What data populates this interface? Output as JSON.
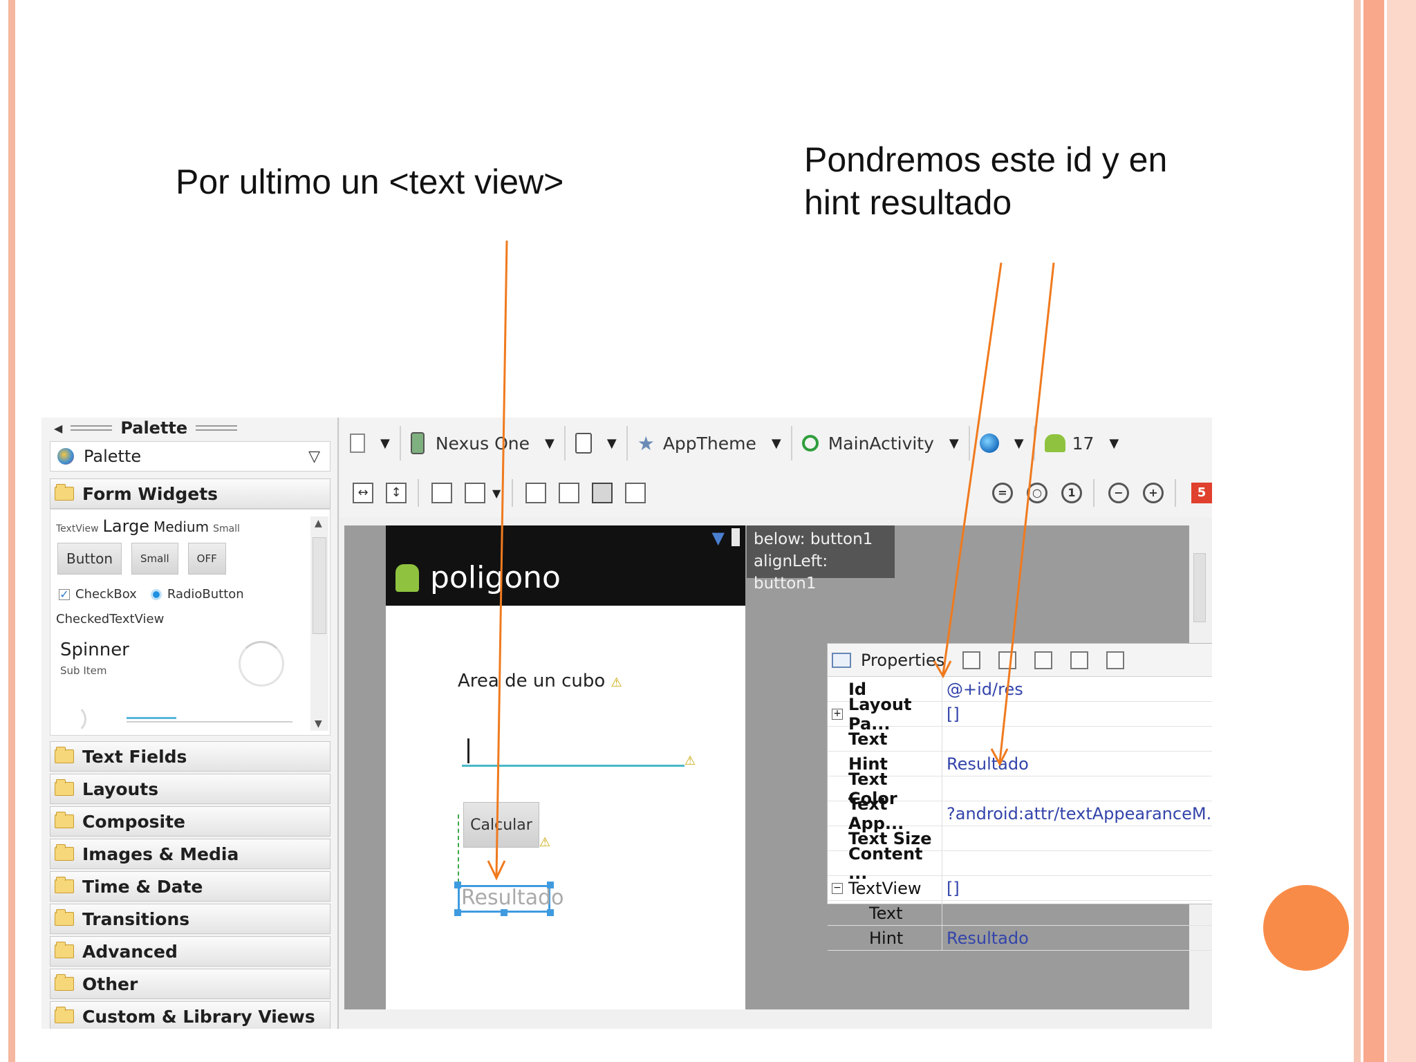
{
  "slide": {
    "note_left": "Por ultimo un <text view>",
    "note_right": "Pondremos este id y en hint resultado"
  },
  "palette": {
    "title": "Palette",
    "dropdown": "Palette",
    "form_widgets": "Form Widgets",
    "widgets": {
      "textview_small": "TextView",
      "large": "Large",
      "medium": "Medium",
      "small": "Small",
      "button": "Button",
      "small_button": "Small",
      "toggle": "OFF",
      "checkbox": "CheckBox",
      "radiobutton": "RadioButton",
      "checked_textview": "CheckedTextView",
      "spinner": "Spinner",
      "sub_item": "Sub Item"
    },
    "categories": [
      "Text Fields",
      "Layouts",
      "Composite",
      "Images & Media",
      "Time & Date",
      "Transitions",
      "Advanced",
      "Other",
      "Custom & Library Views"
    ]
  },
  "toolbar": {
    "device": "Nexus One",
    "theme": "AppTheme",
    "activity": "MainActivity",
    "api_level": "17",
    "badge": "5"
  },
  "device_screen": {
    "app_title": "poligono",
    "tooltip_line1": "below: button1",
    "tooltip_line2": "alignLeft: button1",
    "area_label": "Area de un cubo",
    "button_label": "Calcular",
    "result_hint": "Resultado"
  },
  "properties": {
    "title": "Properties",
    "rows": [
      {
        "name": "Id",
        "value": "@+id/res",
        "style": "bold",
        "button": true
      },
      {
        "name": "Layout Pa...",
        "value": "[]",
        "style": "bold",
        "button": false,
        "expander": "+"
      },
      {
        "name": "Text",
        "value": "",
        "style": "bold",
        "button": true
      },
      {
        "name": "Hint",
        "value": "Resultado",
        "style": "bold",
        "button": true
      },
      {
        "name": "Text Color",
        "value": "",
        "style": "bold",
        "button": true
      },
      {
        "name": "Text App...",
        "value": "?android:attr/textAppearanceM...",
        "style": "bold",
        "button": true
      },
      {
        "name": "Text Size",
        "value": "",
        "style": "bold",
        "button": true
      },
      {
        "name": "Content ...",
        "value": "",
        "style": "bold",
        "button": true
      },
      {
        "name": "TextView",
        "value": "[]",
        "style": "plain",
        "button": false,
        "expander": "−"
      },
      {
        "name": "Text",
        "value": "",
        "style": "indent",
        "button": true
      },
      {
        "name": "Hint",
        "value": "Resultado",
        "style": "indent",
        "button": true
      }
    ]
  },
  "colors": {
    "annotation_arrow": "#f07a1e",
    "slide_accent": "#f98b48"
  }
}
